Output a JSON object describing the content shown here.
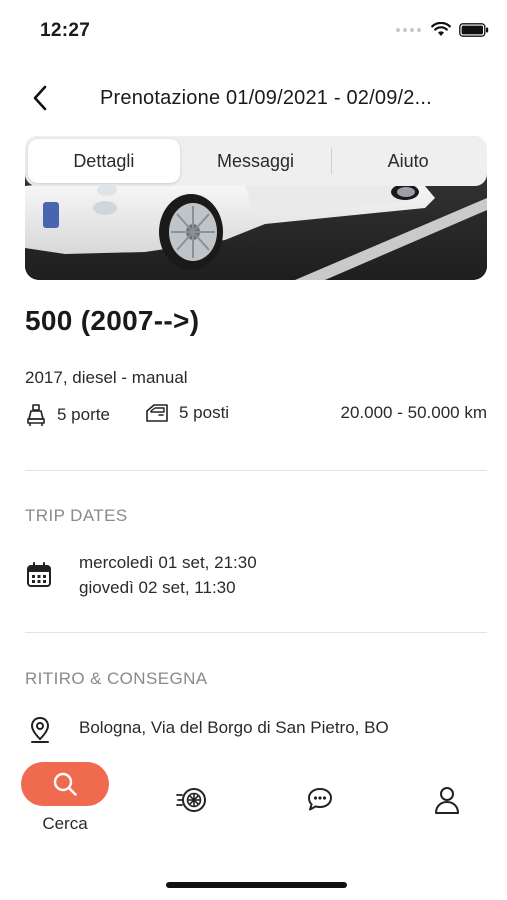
{
  "status_bar": {
    "time": "12:27"
  },
  "header": {
    "title": "Prenotazione 01/09/2021 - 02/09/2..."
  },
  "segments": [
    {
      "label": "Dettagli",
      "active": true
    },
    {
      "label": "Messaggi",
      "active": false
    },
    {
      "label": "Aiuto",
      "active": false
    }
  ],
  "car": {
    "title": "500 (2007-->)",
    "subtitle": "2017, diesel - manual",
    "doors": "5 porte",
    "seats": "5 posti",
    "mileage": "20.000 - 50.000 km"
  },
  "trip": {
    "label": "TRIP DATES",
    "start": "mercoledì 01 set, 21:30",
    "end": "giovedì 02 set, 11:30"
  },
  "pickup": {
    "label": "RITIRO & CONSEGNA",
    "address": "Bologna, Via del Borgo di San Pietro, BO"
  },
  "tabbar": {
    "search_label": "Cerca",
    "icons": [
      "search-icon",
      "steering-wheel-icon",
      "chat-icon",
      "profile-icon"
    ]
  },
  "colors": {
    "accent": "#f06a4f",
    "divider": "#e4e4e4",
    "muted": "#8a8a8a"
  }
}
